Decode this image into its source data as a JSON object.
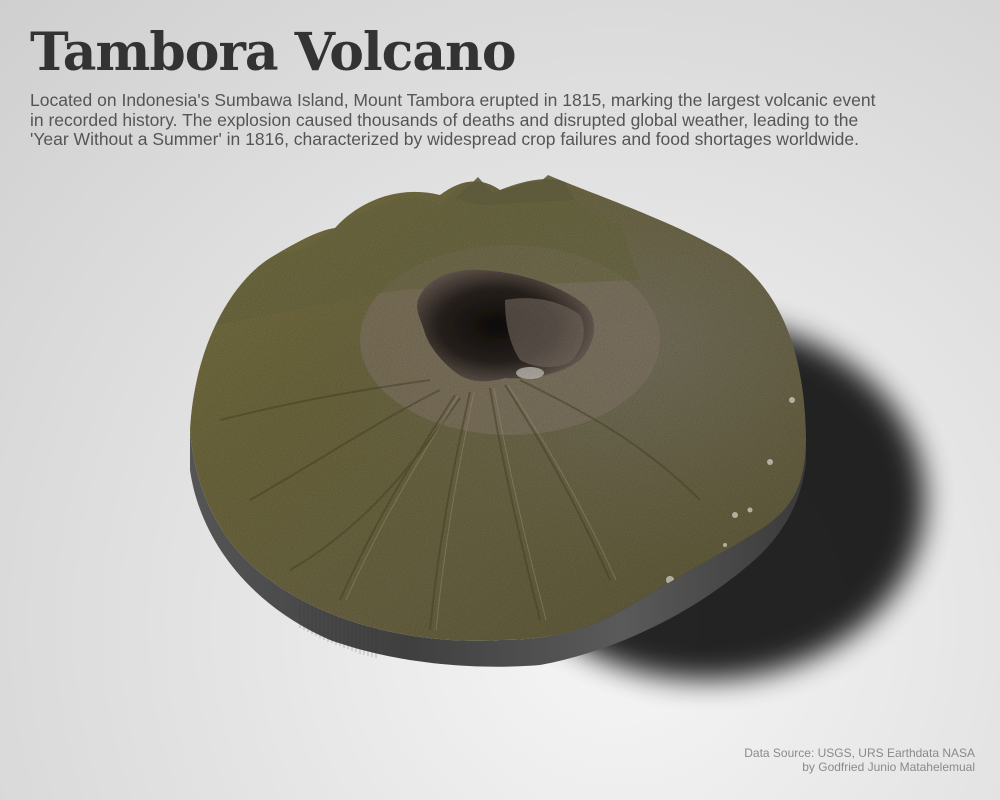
{
  "title": "Tambora Volcano",
  "description_lines": [
    "Located on Indonesia's Sumbawa Island, Mount Tambora erupted in 1815, marking the largest volcanic event",
    "in recorded history. The explosion caused thousands of deaths and disrupted global weather, leading to the",
    "'Year Without a Summer' in 1816, characterized by widespread crop failures and food shortages worldwide."
  ],
  "credits": {
    "source": "Data Source: USGS, URS Earthdata NASA",
    "author": "by Godfried Junio Matahelemual"
  },
  "colors": {
    "title": "#333333",
    "text": "#555555",
    "credits": "#8a8a8a",
    "terrain_olive": "#6e6a3e",
    "terrain_rock": "#857a6a",
    "crater_shadow": "#1e1a17",
    "base_side": "#4a4a4a"
  }
}
